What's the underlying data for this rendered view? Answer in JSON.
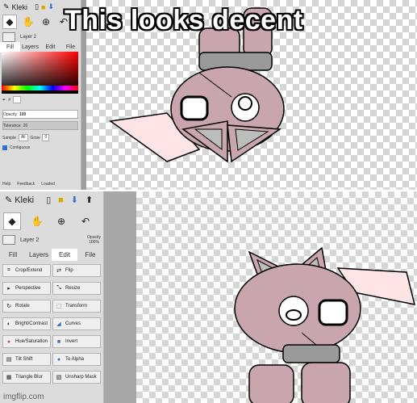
{
  "caption": "This looks decent",
  "watermark": "imgflip.com",
  "top": {
    "app_name": "Kleki",
    "layer_name": "Layer 2",
    "tabs": [
      "Fill",
      "Layers",
      "Edit",
      "File"
    ],
    "opacity_label": "Opacity",
    "opacity_value": "100",
    "tolerance_label": "Tolerance",
    "tolerance_value": "20",
    "sample_label": "Sample",
    "sample_value": "All",
    "grow_label": "Grow",
    "grow_value": "0",
    "contiguous_label": "Contiguous",
    "footer": [
      "Help",
      "Feedback",
      "Loaded"
    ]
  },
  "bottom": {
    "app_name": "Kleki",
    "layer_name": "Layer 2",
    "opacity_label": "Opacity",
    "opacity_value": "100%",
    "tabs": [
      "Fill",
      "Layers",
      "Edit",
      "File"
    ],
    "edit_buttons": [
      "Crop/Extend",
      "Flip",
      "Perspective",
      "Resize",
      "Rotate",
      "Transform",
      "Bright/Contrast",
      "Curves",
      "Hue/Saturation",
      "Invert",
      "Tilt Shift",
      "To Alpha",
      "Triangle Blur",
      "Unsharp Mask"
    ]
  },
  "colors": {
    "fur": "#c9a6ad",
    "ear_inner": "#ffe4e6",
    "collar": "#9a9a9a"
  }
}
